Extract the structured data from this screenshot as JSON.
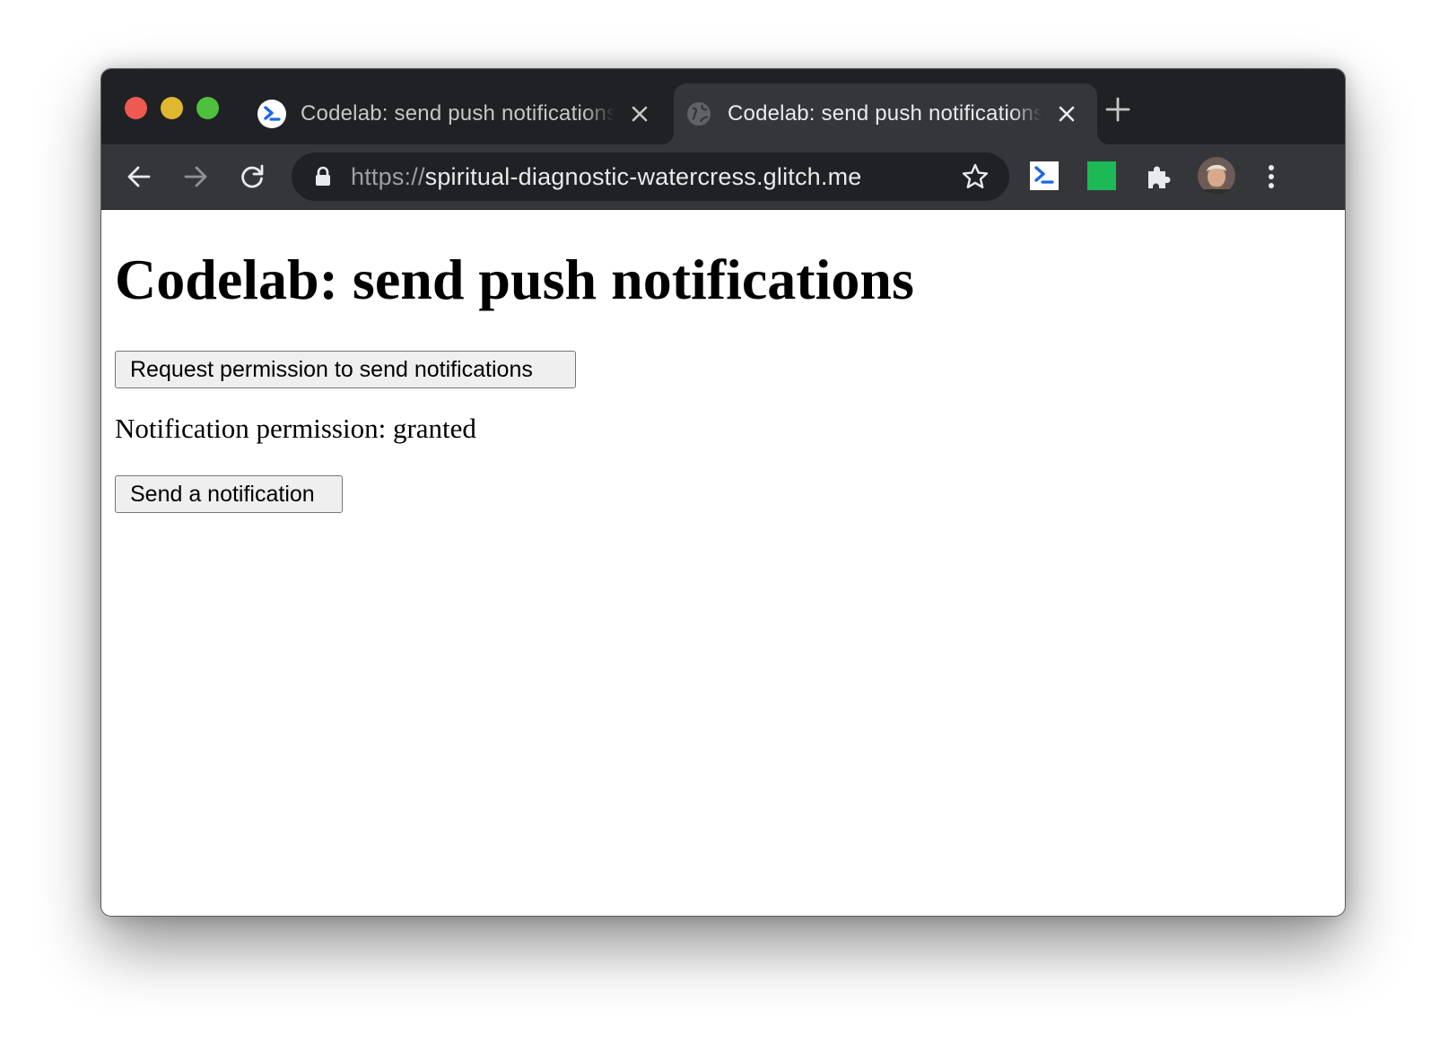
{
  "browser": {
    "tabs": [
      {
        "title": "Codelab: send push notifications",
        "favicon": "terminal-prompt-icon",
        "active": false
      },
      {
        "title": "Codelab: send push notifications",
        "favicon": "globe-icon",
        "active": true
      }
    ],
    "address_bar": {
      "scheme": "https://",
      "host": "spiritual-diagnostic-watercress.glitch.me"
    },
    "extensions": [
      "terminal-extension-icon",
      "green-square-extension-icon",
      "puzzle-extensions-icon"
    ],
    "colors": {
      "frame": "#202124",
      "toolbar": "#35363a",
      "traffic_close": "#ee5a52",
      "traffic_minimize": "#e0b72f",
      "traffic_maximize": "#4fc03e",
      "extension_green": "#1db954",
      "extension_blue": "#1a66e8"
    }
  },
  "page": {
    "heading": "Codelab: send push notifications",
    "request_button_label": "Request permission to send notifications",
    "permission_status": "Notification permission: granted",
    "send_button_label": "Send a notification"
  }
}
